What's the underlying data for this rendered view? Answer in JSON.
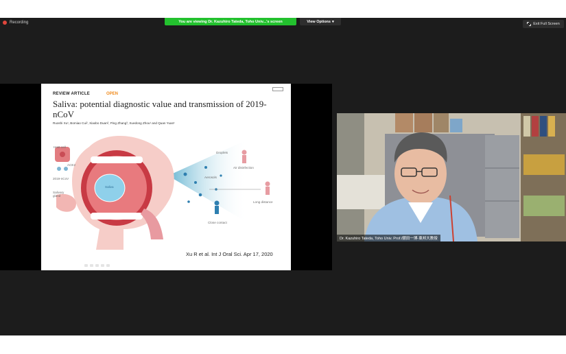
{
  "topbar": {
    "recording_label": "Recording",
    "viewing_banner": "You are viewing Dr. Kazuhiro Tateda, Toho Univ...'s screen",
    "view_options_label": "View Options",
    "exit_fullscreen_label": "Exit Full Screen"
  },
  "slide": {
    "article_type": "REVIEW ARTICLE",
    "open_label": "OPEN",
    "title": "Saliva: potential diagnostic value and transmission of 2019-nCoV",
    "authors": "Ruoshi Xu¹, Bomiao Cui², Xiaobo Duan², Ping Zhang³, Xuedong Zhou¹ and Quan Yuan¹",
    "figure_labels": {
      "host_cell": "Host cell",
      "ace2": "ACE2",
      "virus": "2019-nCoV",
      "salivary_gland": "Salivary gland",
      "saliva": "Saliva",
      "droplets": "Droplets",
      "aerosols": "Aerosols",
      "air_disinfection": "Air disinfection",
      "long_distance": "Long distance",
      "close_contact": "Close contact"
    },
    "citation": "Xu R et al. Int J Oral Sci. Apr 17, 2020"
  },
  "video": {
    "caption": "Dr. Kazuhiro Tateda, Toho Univ. Prof./舘田一博-東邦大教授"
  },
  "colors": {
    "banner_green": "#23c12e",
    "open_orange": "#f08a1c",
    "recording_red": "#e0463c"
  }
}
